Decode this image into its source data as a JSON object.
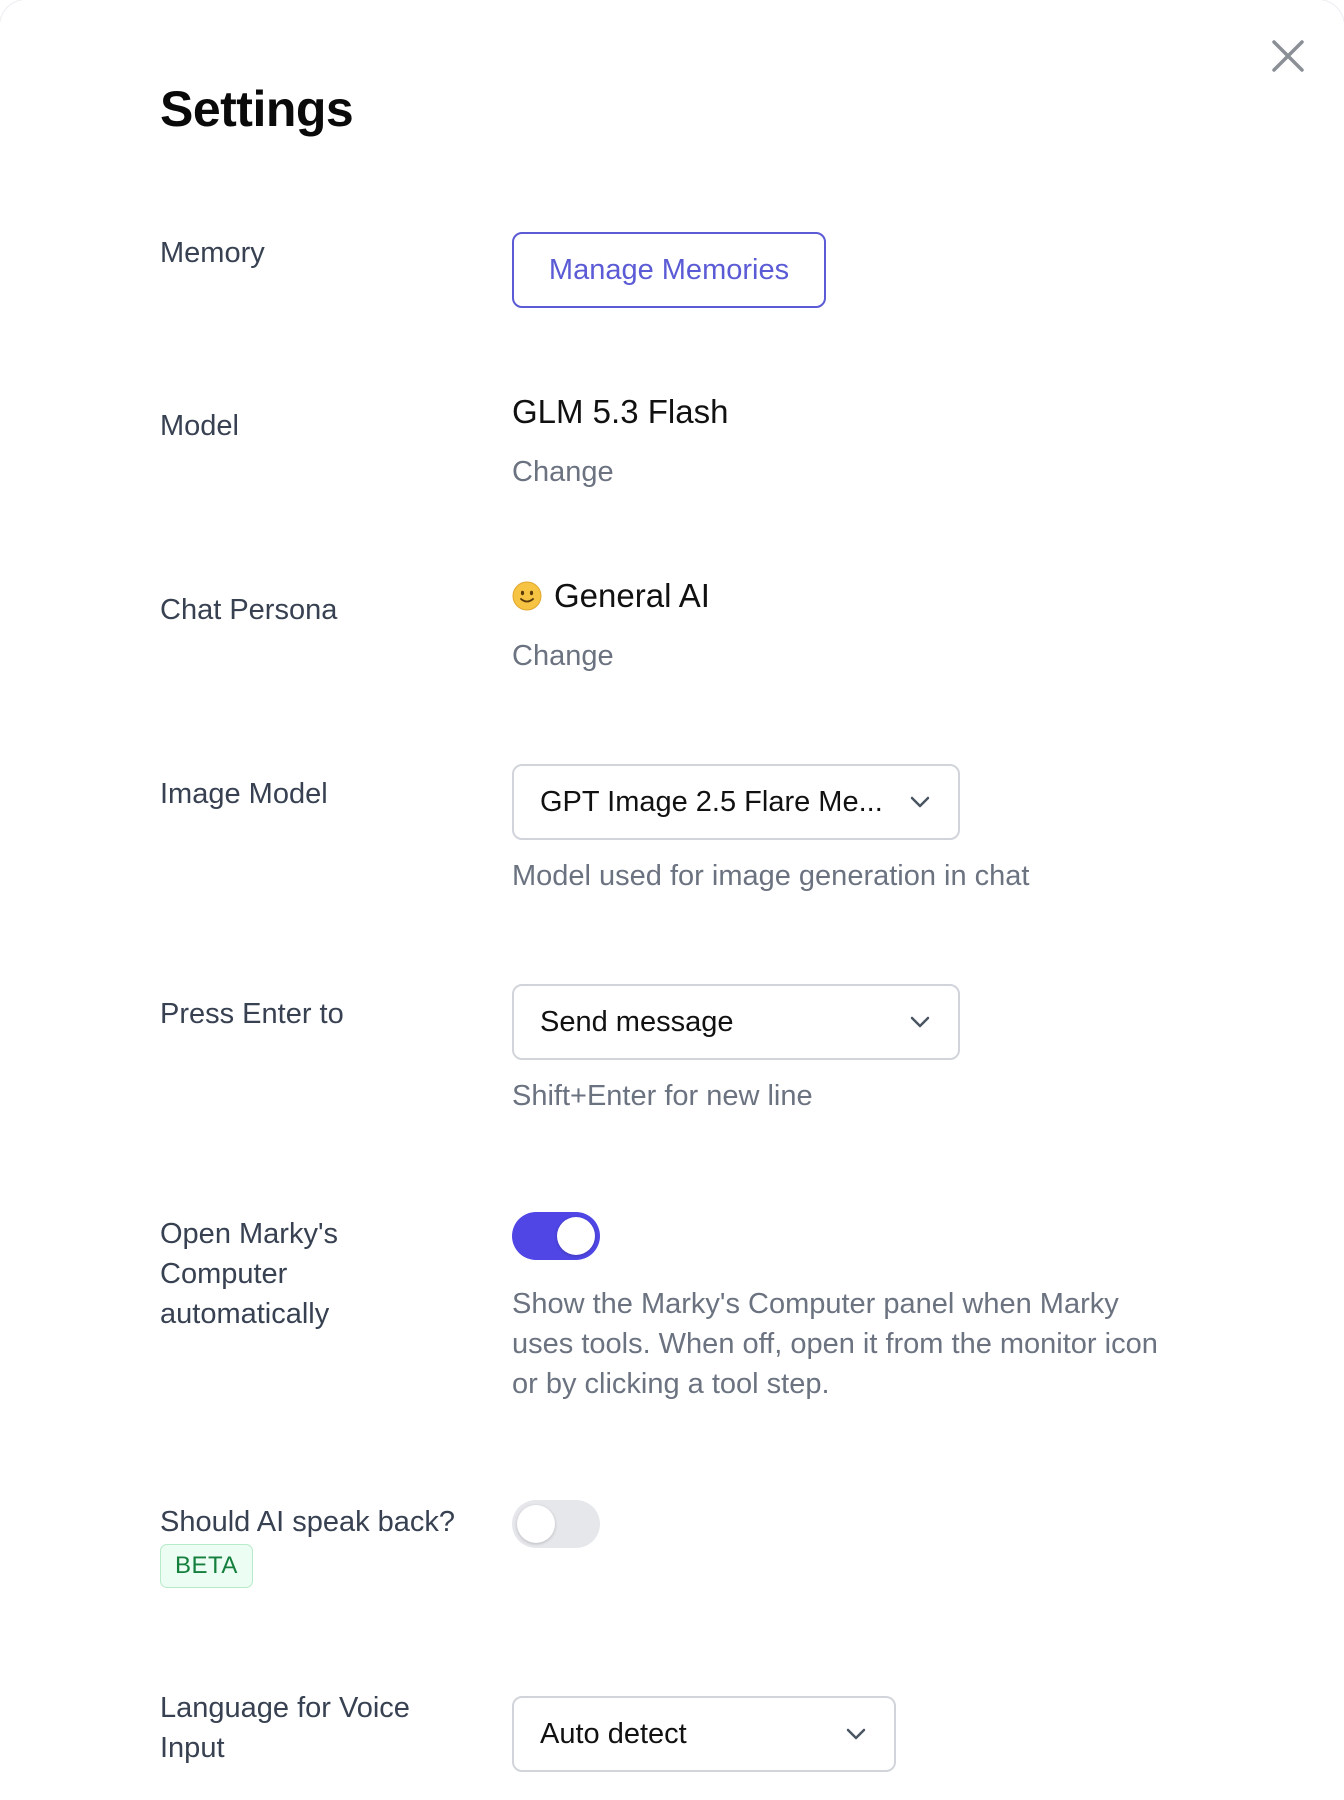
{
  "header": {
    "title": "Settings",
    "close_icon": "close-icon"
  },
  "memory": {
    "label": "Memory",
    "button_label": "Manage Memories",
    "accent_color": "#5b5bd6"
  },
  "model": {
    "label": "Model",
    "value": "GLM 5.3 Flash",
    "change_label": "Change"
  },
  "persona": {
    "label": "Chat Persona",
    "icon": "smiley-face-icon",
    "value": "General AI",
    "change_label": "Change"
  },
  "image_model": {
    "label": "Image Model",
    "selected": "GPT Image 2.5 Flare Me...",
    "hint": "Model used for image generation in chat"
  },
  "enter_key": {
    "label": "Press Enter to",
    "selected": "Send message",
    "hint": "Shift+Enter for new line"
  },
  "computer_panel": {
    "label_line1": "Open Marky's",
    "label_line2": "Computer",
    "label_line3": "automatically",
    "enabled": true,
    "hint_line1": "Show the Marky's Computer panel when Marky",
    "hint_line2": "uses tools. When off, open it from the monitor icon",
    "hint_line3": "or by clicking a tool step.",
    "toggle_color": "#4f46e5"
  },
  "speak_back": {
    "label": "Should AI speak back?",
    "badge": "BETA",
    "enabled": false
  },
  "voice_language": {
    "label_line1": "Language for Voice",
    "label_line2": "Input",
    "selected": "Auto detect"
  }
}
